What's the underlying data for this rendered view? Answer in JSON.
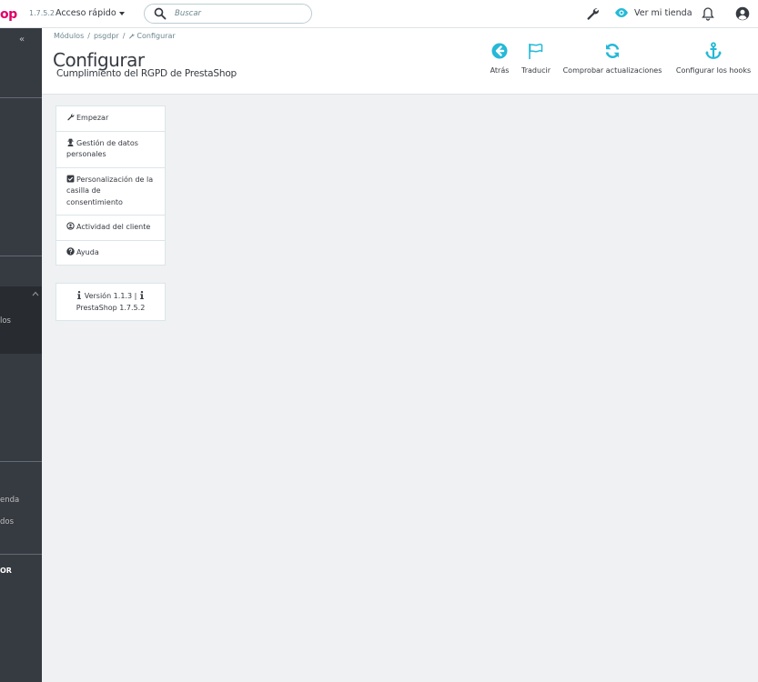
{
  "topbar": {
    "logo": "op",
    "version": "1.7.5.2",
    "quick_access": "Acceso rápido",
    "search_placeholder": "Buscar",
    "view_shop_label": "Ver mi tienda"
  },
  "sidebar": {
    "collapse_icon": "«",
    "items": [
      {
        "label": "los"
      },
      {
        "label": "enda"
      },
      {
        "label": "dos"
      },
      {
        "label": "OR"
      }
    ]
  },
  "header": {
    "breadcrumb": [
      "Módulos",
      "psgdpr",
      "Configurar"
    ],
    "title": "Configurar",
    "subtitle": "Cumplimiento del RGPD de PrestaShop",
    "toolbar": [
      {
        "label": "Atrás",
        "icon": "arrow-left-circle-icon"
      },
      {
        "label": "Traducir",
        "icon": "flag-icon"
      },
      {
        "label": "Comprobar actualizaciones",
        "icon": "refresh-icon"
      },
      {
        "label": "Configurar los hooks",
        "icon": "anchor-icon"
      }
    ]
  },
  "tabs": [
    {
      "label": "Empezar",
      "icon": "wrench-icon"
    },
    {
      "label": "Gestión de datos personales",
      "icon": "user-secret-icon"
    },
    {
      "label": "Personalización de la casilla de consentimiento",
      "icon": "check-square-icon"
    },
    {
      "label": "Actividad del cliente",
      "icon": "user-circle-icon"
    },
    {
      "label": "Ayuda",
      "icon": "question-circle-icon"
    }
  ],
  "version_box": {
    "module_version": "Versión 1.1.3 |",
    "prestashop_version": "PrestaShop 1.7.5.2"
  },
  "colors": {
    "accent": "#25b9d7",
    "logo": "#df0067",
    "sidebar": "#363a41"
  }
}
